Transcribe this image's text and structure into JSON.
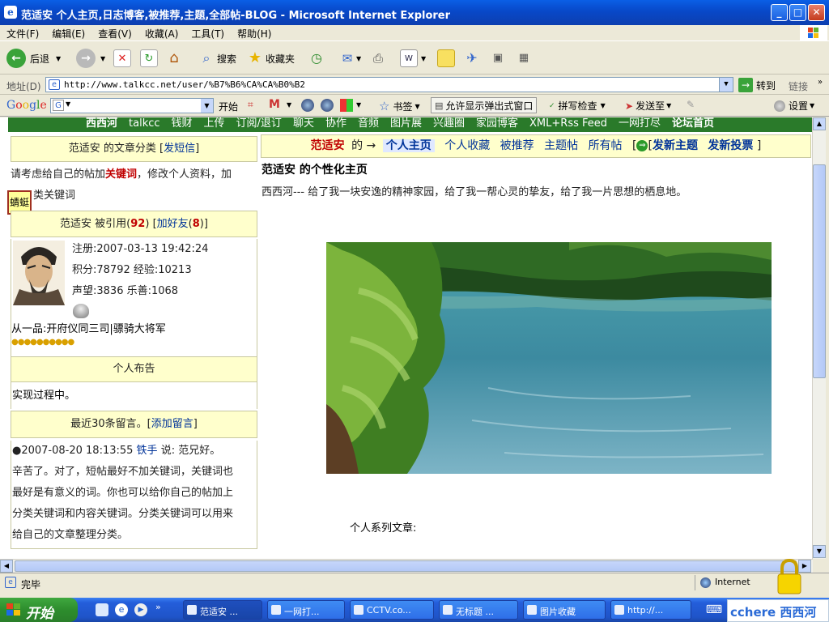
{
  "window": {
    "title": "范适安 个人主页,日志博客,被推荐,主题,全部帖-BLOG - Microsoft Internet Explorer"
  },
  "menu": [
    "文件(F)",
    "编辑(E)",
    "查看(V)",
    "收藏(A)",
    "工具(T)",
    "帮助(H)"
  ],
  "toolbar": {
    "back": "后退",
    "search": "搜索",
    "favorites": "收藏夹"
  },
  "address": {
    "label": "地址(D)",
    "url": "http://www.talkcc.net/user/%B7%B6%CA%CA%B0%B2",
    "go": "转到",
    "links": "链接"
  },
  "googlebar": {
    "brand": "Google",
    "start": "开始",
    "bookmarks": "书签",
    "popup": "允许显示弹出式窗口",
    "spell": "拼写检查",
    "sendto": "发送至",
    "settings": "设置"
  },
  "site_nav": [
    "西西河",
    "talkcc",
    "钱财",
    "上传",
    "订阅/退订",
    "聊天",
    "协作",
    "音频",
    "图片展",
    "兴趣圈",
    "家园博客",
    "XML+Rss Feed",
    "一网打尽",
    "论坛首页"
  ],
  "left": {
    "cat_title": "范适安 的文章分类",
    "cat_link": "发短信",
    "cat_text_a": "请考虑给自己的帖加",
    "cat_kw": "关键词",
    "cat_text_b": "，修改个人资料，加",
    "cat_text_c": "类关键词",
    "tag": "蜻蜓",
    "cited_prefix": "范适安 被引用(",
    "cited_count": "92",
    "cited_mid": ") [",
    "friend_link": "加好友",
    "friend_paren_open": "(",
    "friend_count": "8",
    "friend_suffix": ")]",
    "reg": "注册:2007-03-13 19:42:24",
    "points": "积分:78792 经验:10213",
    "fame": "声望:3836 乐善:1068",
    "rank": "从一品:开府仪同三司|骠骑大将军",
    "notice_title": "个人布告",
    "notice_text": "实现过程中。",
    "msgs_title": "最近30条留言。[",
    "msgs_link": "添加留言",
    "msgs_close": "]",
    "msg_head": "●2007-08-20 18:13:55 ",
    "msg_user": "铁手",
    "msg_says": " 说: 范兄好。",
    "msg_lines": [
      "辛苦了。对了，短帖最好不加关键词，关键词也",
      "最好是有意义的词。你也可以给你自己的帖加上",
      "分类关键词和内容关键词。分类关键词可以用来",
      "给自己的文章整理分类。"
    ]
  },
  "right": {
    "user": "范适安",
    "tabs_mid": "的 →",
    "tabs": [
      "个人主页",
      "个人收藏",
      "被推荐",
      "主题帖",
      "所有帖"
    ],
    "new_topic": "发新主题",
    "new_vote": "发新投票",
    "heading": "范适安 的个性化主页",
    "intro": "西西河--- 给了我一块安逸的精神家园，给了我一帮心灵的挚友，给了我一片思想的栖息地。",
    "series": "个人系列文章:"
  },
  "status": {
    "text": "完毕",
    "zone": "Internet"
  },
  "taskbar": {
    "start": "开始",
    "tasks": [
      "范适安 ...",
      "一网打...",
      "CCTV.co...",
      "无标题 ...",
      "图片收藏",
      "http://..."
    ],
    "ime": "cchere 西西河"
  }
}
